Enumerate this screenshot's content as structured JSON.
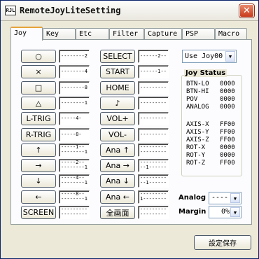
{
  "window": {
    "title": "RemoteJoyLiteSetting",
    "icon_text": "RJL",
    "close_glyph": "✕"
  },
  "tabs": [
    {
      "label": "Joy",
      "active": true
    },
    {
      "label": "Key"
    },
    {
      "label": "Etc"
    },
    {
      "label": "Filter"
    },
    {
      "label": "Capture"
    },
    {
      "label": "PSP"
    },
    {
      "label": "Macro"
    }
  ],
  "left_buttons": [
    {
      "label": "○",
      "binding": [
        "--------2"
      ]
    },
    {
      "label": "×",
      "binding": [
        "--------4"
      ]
    },
    {
      "label": "□",
      "binding": [
        "--------8"
      ]
    },
    {
      "label": "△",
      "binding": [
        "--------1"
      ]
    },
    {
      "label": "L-TRIG",
      "binding": [
        "-----4-"
      ]
    },
    {
      "label": "R-TRIG",
      "binding": [
        "-----8-"
      ]
    },
    {
      "label": "↑",
      "binding": [
        "-----1--",
        "--------1"
      ]
    },
    {
      "label": "→",
      "binding": [
        "-----2--",
        "--------1"
      ]
    },
    {
      "label": "↓",
      "binding": [
        "-----4--",
        "--------1"
      ]
    },
    {
      "label": "←",
      "binding": [
        "-----8--",
        "--------1"
      ]
    },
    {
      "label": "SCREEN",
      "binding": [
        "---------",
        "---------"
      ]
    }
  ],
  "mid_buttons": [
    {
      "label": "SELECT",
      "binding": [
        "------2--"
      ]
    },
    {
      "label": "START",
      "binding": [
        "------1--"
      ]
    },
    {
      "label": "HOME",
      "binding": [
        "---------"
      ]
    },
    {
      "label": "♪",
      "binding": [
        "---------"
      ]
    },
    {
      "label": "VOL+",
      "binding": [
        "---------"
      ]
    },
    {
      "label": "VOL-",
      "binding": [
        "---------"
      ]
    },
    {
      "label": "Ana ↑",
      "binding": [
        "---------",
        "---------"
      ]
    },
    {
      "label": "Ana →",
      "binding": [
        "---------",
        "--1------"
      ]
    },
    {
      "label": "Ana ↓",
      "binding": [
        "---------",
        "--1------"
      ]
    },
    {
      "label": "Ana ←",
      "binding": [
        "---------",
        "1--------"
      ]
    },
    {
      "label": "全画面",
      "binding": [
        "---------",
        "---------"
      ]
    }
  ],
  "joy_select": {
    "value": "Use Joy00"
  },
  "joy_status": {
    "title": "Joy Status",
    "rows": [
      {
        "name": "BTN-LO",
        "value": "0000"
      },
      {
        "name": "BTN-HI",
        "value": "0000"
      },
      {
        "name": "POV",
        "value": "0000"
      },
      {
        "name": "ANALOG",
        "value": "0000"
      },
      {
        "name": "AXIS-X",
        "value": "FF00"
      },
      {
        "name": "AXIS-Y",
        "value": "FF00"
      },
      {
        "name": "AXIS-Z",
        "value": "FF00"
      },
      {
        "name": "ROT-X",
        "value": "0000"
      },
      {
        "name": "ROT-Y",
        "value": "0000"
      },
      {
        "name": "ROT-Z",
        "value": "FF00"
      }
    ]
  },
  "analog": {
    "label": "Analog",
    "value": "----"
  },
  "margin": {
    "label": "Margin",
    "value": "0%"
  },
  "save_button": {
    "label": "設定保存"
  }
}
